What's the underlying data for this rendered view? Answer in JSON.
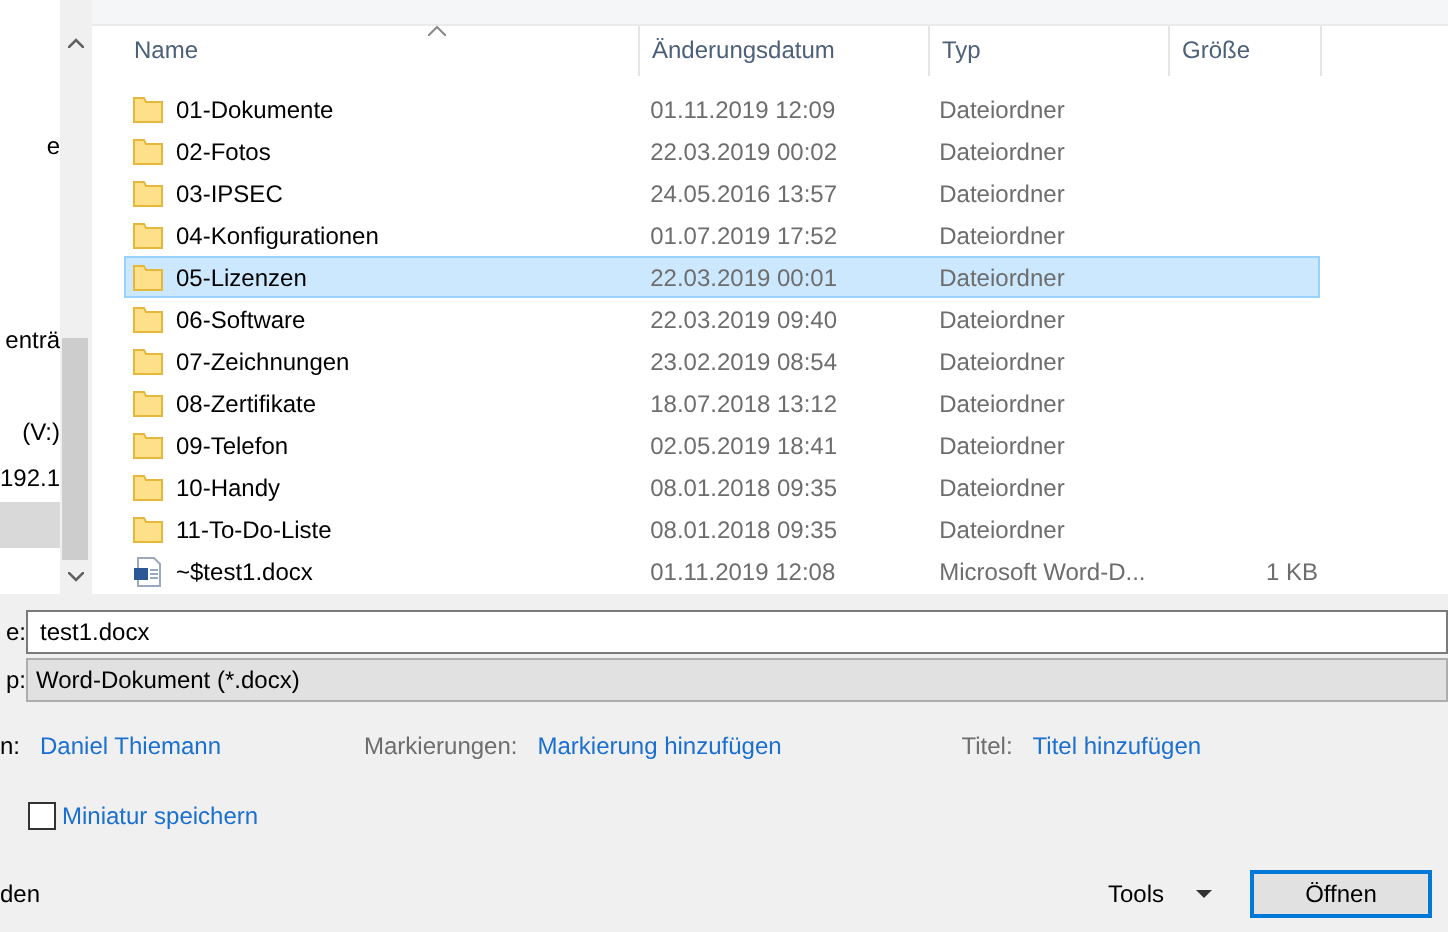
{
  "sidebar": {
    "items": [
      {
        "label": "e",
        "selected": false
      },
      {
        "label": "enträ",
        "selected": false
      },
      {
        "label": "(V:)",
        "selected": false
      },
      {
        "label": "192.1",
        "selected": false
      },
      {
        "selected": true
      }
    ]
  },
  "table": {
    "columns": [
      "Name",
      "Änderungsdatum",
      "Typ",
      "Größe"
    ],
    "rows": [
      {
        "kind": "folder",
        "name": "01-Dokumente",
        "date": "01.11.2019 12:09",
        "type": "Dateiordner",
        "selected": false
      },
      {
        "kind": "folder",
        "name": "02-Fotos",
        "date": "22.03.2019 00:02",
        "type": "Dateiordner",
        "selected": false
      },
      {
        "kind": "folder",
        "name": "03-IPSEC",
        "date": "24.05.2016 13:57",
        "type": "Dateiordner",
        "selected": false
      },
      {
        "kind": "folder",
        "name": "04-Konfigurationen",
        "date": "01.07.2019 17:52",
        "type": "Dateiordner",
        "selected": false
      },
      {
        "kind": "folder",
        "name": "05-Lizenzen",
        "date": "22.03.2019 00:01",
        "type": "Dateiordner",
        "selected": true
      },
      {
        "kind": "folder",
        "name": "06-Software",
        "date": "22.03.2019 09:40",
        "type": "Dateiordner",
        "selected": false
      },
      {
        "kind": "folder",
        "name": "07-Zeichnungen",
        "date": "23.02.2019 08:54",
        "type": "Dateiordner",
        "selected": false
      },
      {
        "kind": "folder",
        "name": "08-Zertifikate",
        "date": "18.07.2018 13:12",
        "type": "Dateiordner",
        "selected": false
      },
      {
        "kind": "folder",
        "name": "09-Telefon",
        "date": "02.05.2019 18:41",
        "type": "Dateiordner",
        "selected": false
      },
      {
        "kind": "folder",
        "name": "10-Handy",
        "date": "08.01.2018 09:35",
        "type": "Dateiordner",
        "selected": false
      },
      {
        "kind": "folder",
        "name": "11-To-Do-Liste",
        "date": "08.01.2018 09:35",
        "type": "Dateiordner",
        "selected": false
      },
      {
        "kind": "document",
        "name": "~$test1.docx",
        "date": "01.11.2019 12:08",
        "type": "Microsoft Word-D...",
        "size": "1 KB",
        "selected": false
      }
    ]
  },
  "filename": {
    "label": "e:",
    "value": "test1.docx"
  },
  "filetype": {
    "label": "p:",
    "value": "Word-Dokument (*.docx)"
  },
  "meta": {
    "author_label": "n:",
    "author": "Daniel Thiemann",
    "tags_label": "Markierungen:",
    "tags": "Markierung hinzufügen",
    "title_label": "Titel:",
    "title": "Titel hinzufügen"
  },
  "thumbnail": {
    "label": "Miniatur speichern",
    "checked": false
  },
  "footer": {
    "left_text": "den",
    "tools": "Tools",
    "open": "Öffnen"
  }
}
